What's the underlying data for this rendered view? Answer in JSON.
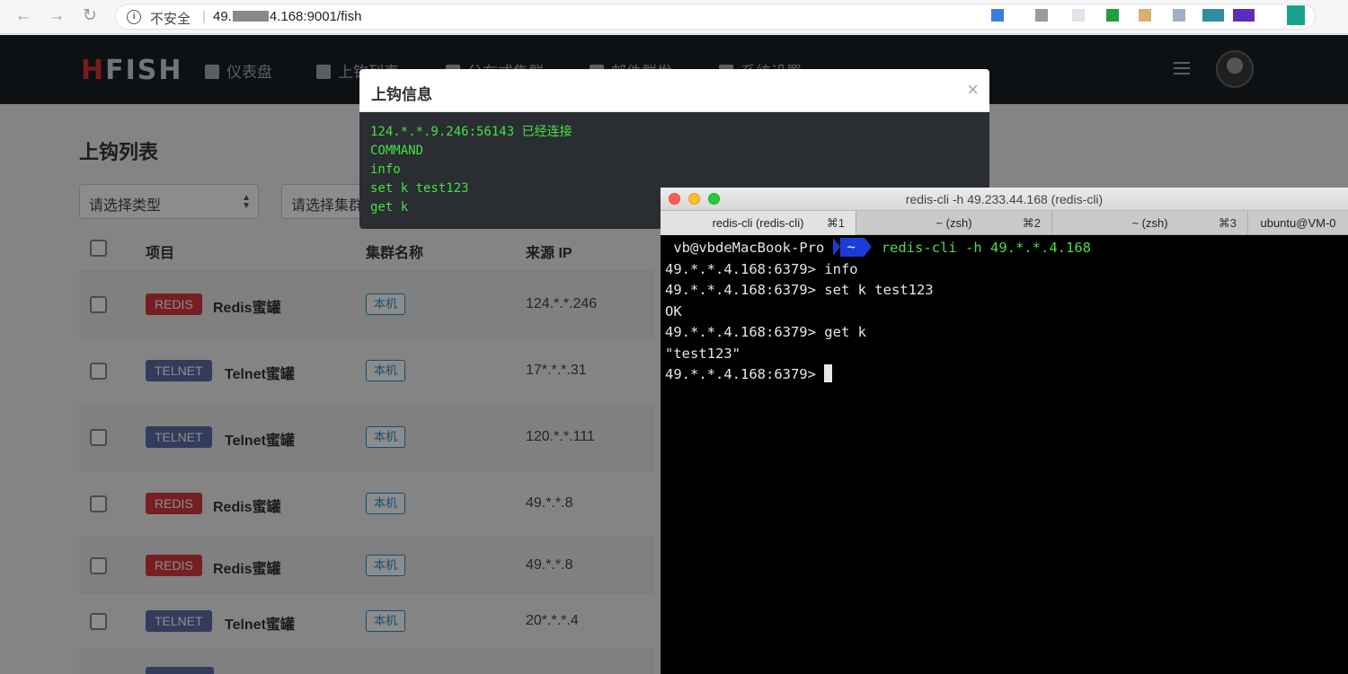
{
  "browser": {
    "insecure_label": "不安全",
    "url_prefix": "49.",
    "url_suffix": "4.168:9001/fish"
  },
  "app": {
    "logo": "HFISH",
    "menu": [
      {
        "label": "仪表盘",
        "icon": "grid-icon"
      },
      {
        "label": "上钩列表",
        "icon": "fish-hook-icon"
      },
      {
        "label": "分布式集群",
        "icon": "cloud-icon"
      },
      {
        "label": "邮件群发",
        "icon": "mail-icon"
      },
      {
        "label": "系统设置",
        "icon": "gear-icon"
      }
    ]
  },
  "page": {
    "title": "上钩列表",
    "type_select": "请选择类型",
    "cluster_select": "请选择集群",
    "columns": {
      "project": "项目",
      "cluster": "集群名称",
      "source_ip": "来源 IP"
    },
    "rows": [
      {
        "tag": "REDIS",
        "name": "Redis蜜罐",
        "cluster": "本机",
        "ip": "124.*.*.246"
      },
      {
        "tag": "TELNET",
        "name": "Telnet蜜罐",
        "cluster": "本机",
        "ip": "17*.*.*.31"
      },
      {
        "tag": "TELNET",
        "name": "Telnet蜜罐",
        "cluster": "本机",
        "ip": "120.*.*.111"
      },
      {
        "tag": "REDIS",
        "name": "Redis蜜罐",
        "cluster": "本机",
        "ip": "49.*.*.8"
      },
      {
        "tag": "REDIS",
        "name": "Redis蜜罐",
        "cluster": "本机",
        "ip": "49.*.*.8"
      },
      {
        "tag": "TELNET",
        "name": "Telnet蜜罐",
        "cluster": "本机",
        "ip": "20*.*.*.4"
      }
    ]
  },
  "modal": {
    "title": "上钩信息",
    "close": "×",
    "lines": [
      "124.*.*.9.246:56143 已经连接",
      "COMMAND",
      "info",
      "set k test123",
      "get k"
    ]
  },
  "terminal": {
    "title": "redis-cli -h 49.233.44.168 (redis-cli)",
    "tabs": [
      {
        "label": "redis-cli (redis-cli)",
        "shortcut": "⌘1"
      },
      {
        "label": "~ (zsh)",
        "shortcut": "⌘2"
      },
      {
        "label": "~ (zsh)",
        "shortcut": "⌘3"
      },
      {
        "label": "ubuntu@VM-0",
        "shortcut": ""
      }
    ],
    "prompt_user": "vb@vbdeMacBook-Pro",
    "prompt_dir": "~",
    "first_cmd": "redis-cli -h 49.*.*.4.168",
    "lines": [
      "49.*.*.4.168:6379> info",
      "49.*.*.4.168:6379> set k test123",
      "OK",
      "49.*.*.4.168:6379> get k",
      "\"test123\"",
      "49.*.*.4.168:6379> "
    ]
  }
}
